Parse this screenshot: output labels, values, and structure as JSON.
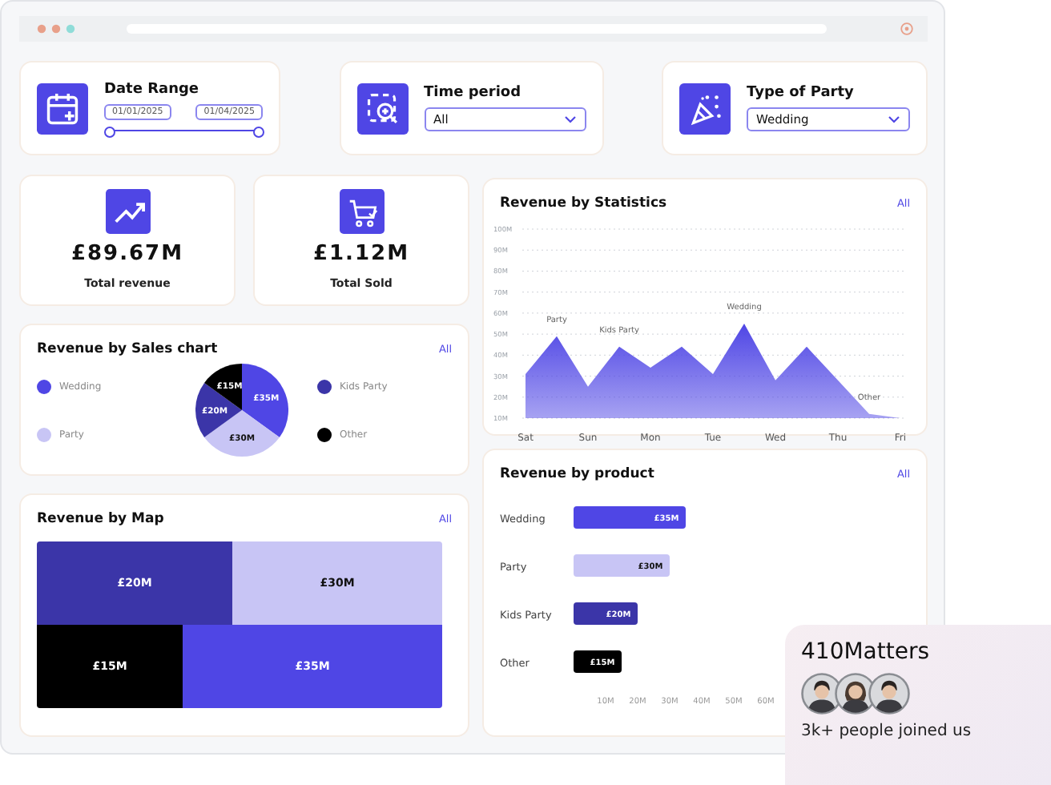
{
  "filters": [
    {
      "kind": "date_range",
      "title": "Date Range",
      "start": "01/01/2025",
      "end": "01/04/2025",
      "level": 1
    },
    {
      "kind": "select",
      "title": "Time period",
      "value": "All"
    },
    {
      "kind": "select",
      "title": "Type of Party",
      "value": "Wedding"
    }
  ],
  "stats": [
    {
      "value": "£89.67M",
      "label": "Total revenue"
    },
    {
      "value": "£1.12M",
      "label": "Total Sold"
    }
  ],
  "sales_chart": {
    "title": "Revenue by Sales chart",
    "link": "All",
    "chart_data": {
      "type": "pie",
      "categories": [
        "Wedding",
        "Party",
        "Kids Party",
        "Other"
      ],
      "values": [
        35,
        30,
        20,
        15
      ],
      "colors": [
        "#4f46e5",
        "#c8c5f5",
        "#3b35a8",
        "#000000"
      ],
      "data_labels": true,
      "value_labels": [
        "£35M",
        "£30M",
        "£20M",
        "£15M"
      ]
    }
  },
  "map": {
    "title": "Revenue by Map",
    "link": "All",
    "rows": [
      {
        "tiles": [
          {
            "label": "£20M",
            "color": "#3b35a8"
          },
          {
            "label": "£30M",
            "color": "#c8c5f5"
          }
        ]
      },
      {
        "tiles": [
          {
            "label": "£15M",
            "color": "#000000"
          },
          {
            "label": "£35M",
            "color": "#4f46e5"
          }
        ]
      }
    ]
  },
  "statistics": {
    "title": "Revenue by Statistics",
    "link": "All",
    "chart_data": {
      "type": "area",
      "categories": [
        "Sat",
        null,
        "Sun",
        null,
        "Mon",
        null,
        "Tue",
        null,
        "Wed",
        null,
        "Thu",
        null,
        "Fri"
      ],
      "series": [
        {
          "color": "#4f46e5",
          "values": [
            31,
            49,
            25,
            44,
            34,
            44,
            31,
            55,
            28,
            44,
            28,
            12,
            10
          ]
        }
      ],
      "ylim": [
        10,
        100
      ],
      "yticks": [
        {
          "value": 10,
          "label": "10M"
        },
        {
          "value": 20,
          "label": "20M"
        },
        {
          "value": 30,
          "label": "30M"
        },
        {
          "value": 40,
          "label": "40M"
        },
        {
          "value": 50,
          "label": "50M"
        },
        {
          "value": 60,
          "label": "60M"
        },
        {
          "value": 70,
          "label": "70M"
        },
        {
          "value": 80,
          "label": "80M"
        },
        {
          "value": 90,
          "label": "90M"
        },
        {
          "value": 100,
          "label": "100M"
        }
      ],
      "grid": true,
      "annotations": [
        "Party",
        "Kids Party",
        "Wedding",
        "Other"
      ]
    }
  },
  "product": {
    "title": "Revenue by product",
    "link": "All",
    "chart_data": {
      "type": "bar",
      "orientation": "horizontal",
      "categories": [
        "Wedding",
        "Party",
        "Kids Party",
        "Other"
      ],
      "values": [
        35,
        30,
        20,
        15
      ],
      "colors": [
        "#4f46e5",
        "#c8c5f5",
        "#3b35a8",
        "#000000"
      ],
      "data_labels": true,
      "value_labels": [
        "£35M",
        "£30M",
        "£20M",
        "£15M"
      ],
      "xlim": [
        0,
        60
      ],
      "xticks": [
        {
          "value": 10,
          "label": "10M"
        },
        {
          "value": 20,
          "label": "20M"
        },
        {
          "value": 30,
          "label": "30M"
        },
        {
          "value": 40,
          "label": "40M"
        },
        {
          "value": 50,
          "label": "50M"
        },
        {
          "value": 60,
          "label": "60M"
        }
      ]
    }
  },
  "promo": {
    "title": "410Matters",
    "avatars": [
      {
        "kind": "man"
      },
      {
        "kind": "woman"
      },
      {
        "kind": "man"
      }
    ],
    "text": "3k+ people joined us"
  }
}
